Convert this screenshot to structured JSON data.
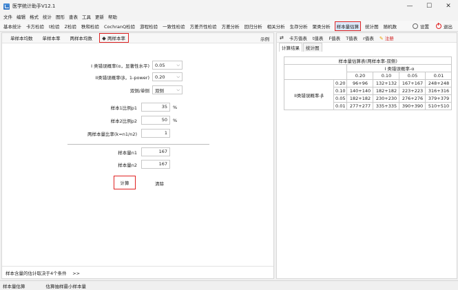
{
  "window": {
    "title": "医学统计助手V12.1",
    "min": "—",
    "max": "☐",
    "close": "✕"
  },
  "menu": [
    "文件",
    "编辑",
    "格式",
    "统计",
    "图形",
    "查表",
    "工具",
    "更新",
    "帮助"
  ],
  "toolbar": {
    "items": [
      "基本统计",
      "卡方检验",
      "t检验",
      "Z检验",
      "秩和检验",
      "CochranQ检验",
      "游程检验",
      "一致性检验",
      "方差齐性检验",
      "方差分析",
      "回归分析",
      "相关分析",
      "生存分析",
      "聚类分析",
      "样本量估算",
      "统计图",
      "随机数"
    ],
    "active_index": 14,
    "settings": "设置",
    "exit": "退出"
  },
  "left_tabs": {
    "items": [
      "单样本均数",
      "单样本率",
      "两样本均数",
      "两样本率"
    ],
    "active_index": 3,
    "example": "示例"
  },
  "form": {
    "alpha_label": "I 类错误概率(α，显著性水平)",
    "alpha_value": "0.05",
    "beta_label": "II类错误概率(β，1-power)",
    "beta_value": "0.20",
    "sides_label": "双侧/单侧",
    "sides_value": "双侧",
    "p1_label": "样本1比例p1",
    "p1_value": "35",
    "p1_unit": "%",
    "p2_label": "样本2比例p2",
    "p2_value": "50",
    "p2_unit": "%",
    "ratio_label": "两样本量比率(k=n1/n2)",
    "ratio_value": "1",
    "n1_label": "样本量n1",
    "n1_value": "167",
    "n2_label": "样本量n2",
    "n2_value": "167",
    "calc_button": "计算",
    "clear_button": "清除"
  },
  "footer_note": "样本含量的估计取决于4个条件 　>>",
  "right_tabs": {
    "items": [
      "卡方值表",
      "t值表",
      "F值表",
      "T值表",
      "r值表"
    ],
    "note": "注册"
  },
  "result_tabs": [
    "计算结果",
    "统计图"
  ],
  "result_table": {
    "title": "样本量估算表(两样本率-双侧)",
    "alpha_header": "I 类错误概率-α",
    "beta_header": "II类错误概率-β",
    "alpha_values": [
      "0.20",
      "0.10",
      "0.05",
      "0.01"
    ],
    "rows": [
      {
        "beta": "0.20",
        "cells": [
          "96+96",
          "132+132",
          "167+167",
          "248+248"
        ]
      },
      {
        "beta": "0.10",
        "cells": [
          "140+140",
          "182+182",
          "223+223",
          "316+316"
        ]
      },
      {
        "beta": "0.05",
        "cells": [
          "182+182",
          "230+230",
          "276+276",
          "379+379"
        ]
      },
      {
        "beta": "0.01",
        "cells": [
          "277+277",
          "335+335",
          "390+390",
          "510+510"
        ]
      }
    ]
  },
  "statusbar": [
    "样本量估算",
    "估算抽样最小样本量"
  ]
}
